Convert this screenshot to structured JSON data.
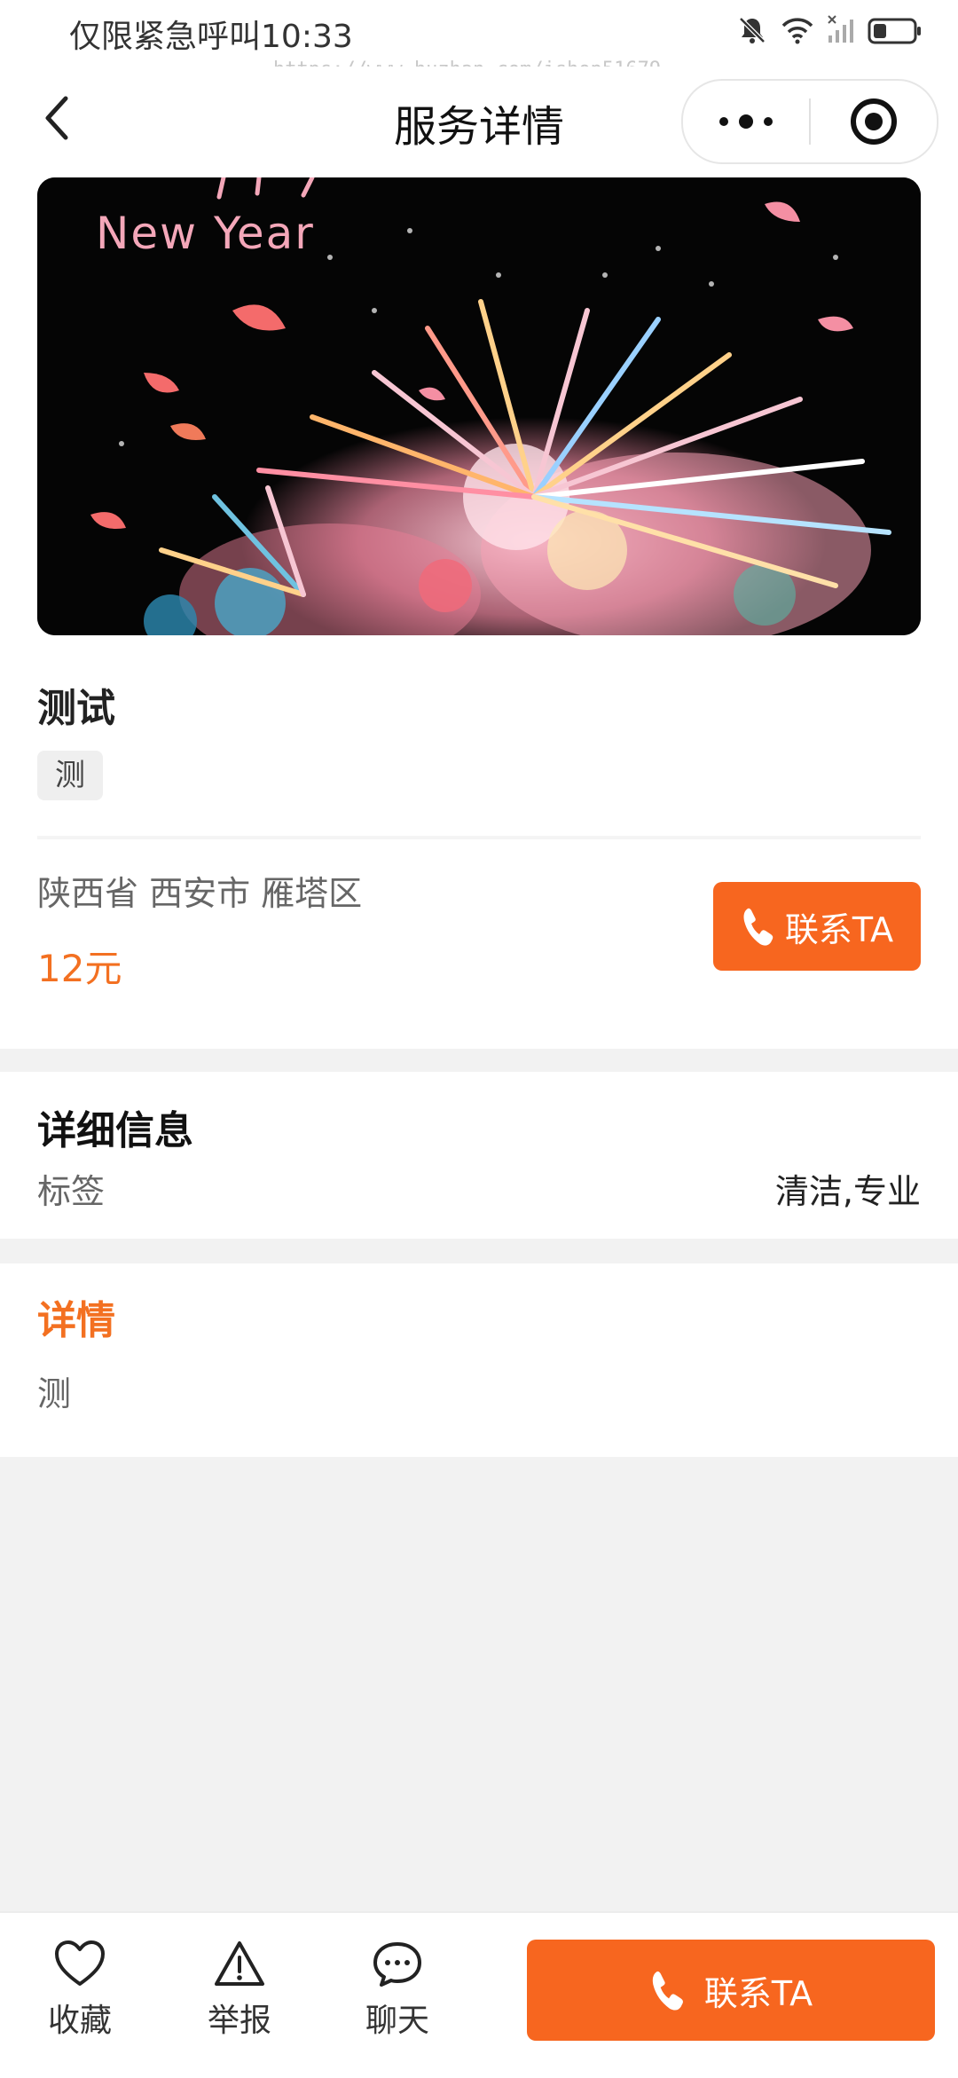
{
  "status_bar": {
    "carrier": "仅限紧急呼叫",
    "time": "10:33",
    "watermark": "https://www.huzhan.com/ishop51679"
  },
  "nav": {
    "title": "服务详情",
    "back_icon": "chevron-left-icon",
    "more_icon": "more-dots-icon",
    "close_icon": "target-circle-icon"
  },
  "banner": {
    "caption": "New Year"
  },
  "service": {
    "title": "测试",
    "tag": "测",
    "location": "陕西省 西安市 雁塔区",
    "price": "12元",
    "contact_label": "联系TA"
  },
  "info": {
    "heading": "详细信息",
    "tag_label": "标签",
    "tag_value": "清洁,专业"
  },
  "details": {
    "heading": "详情",
    "text": "测"
  },
  "bottom_bar": {
    "favorite": "收藏",
    "report": "举报",
    "chat": "聊天",
    "contact": "联系TA"
  },
  "colors": {
    "accent": "#f7661f",
    "price": "#f37021"
  }
}
